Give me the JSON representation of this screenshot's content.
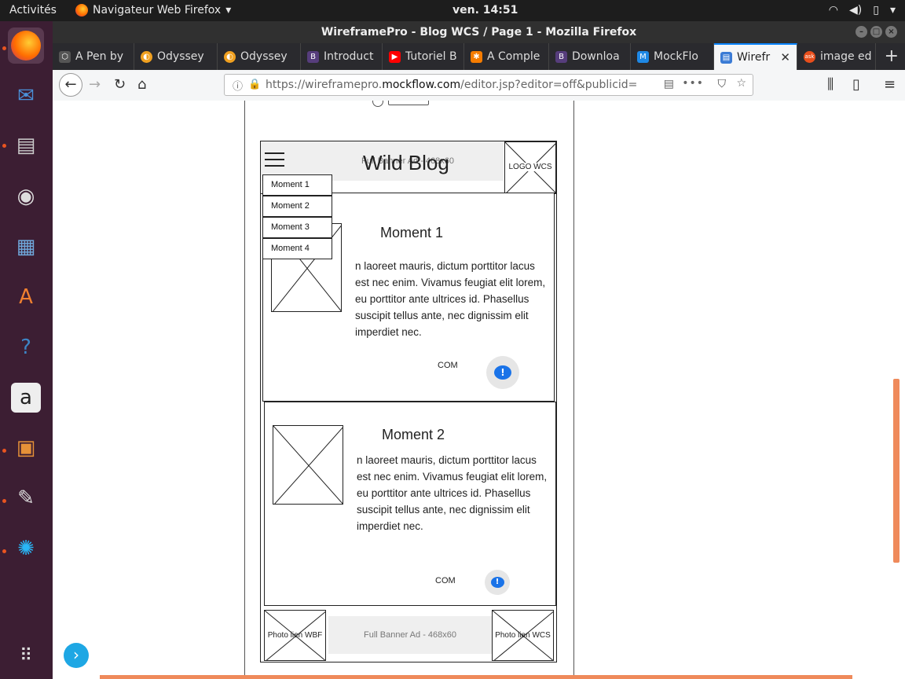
{
  "topbar": {
    "activities": "Activités",
    "app_name": "Navigateur Web Firefox",
    "clock": "ven. 14:51"
  },
  "window": {
    "title": "WireframePro - Blog WCS / Page 1 - Mozilla Firefox"
  },
  "tabs": [
    {
      "label": "A Pen by",
      "icon": "codepen-icon",
      "color": "#444444"
    },
    {
      "label": "Odyssey",
      "icon": "odyssey-icon",
      "color": "#f0a020"
    },
    {
      "label": "Odyssey",
      "icon": "odyssey-icon",
      "color": "#f0a020"
    },
    {
      "label": "Introduct",
      "icon": "bootstrap-icon",
      "color": "#563d7c"
    },
    {
      "label": "Tutoriel B",
      "icon": "youtube-icon",
      "color": "#ff0000"
    },
    {
      "label": "A Comple",
      "icon": "asterisk-icon",
      "color": "#f57c00"
    },
    {
      "label": "Downloa",
      "icon": "bootstrap-icon",
      "color": "#563d7c"
    },
    {
      "label": "MockFlo",
      "icon": "mockflow-icon",
      "color": "#1e88e5"
    },
    {
      "label": "Wirefr",
      "icon": "wireframe-icon",
      "color": "#3a7bd5"
    },
    {
      "label": "image ed",
      "icon": "ask-icon",
      "color": "#e94e1b"
    }
  ],
  "nav": {
    "url_prefix": "https://wireframepro.",
    "url_domain": "mockflow.com",
    "url_suffix": "/editor.jsp?editor=off&publicid="
  },
  "wireframe": {
    "header": {
      "title": "Wild Blog",
      "banner_text": "Full Banner Ad - 468x60",
      "logo_label": "LOGO WCS"
    },
    "menu": [
      "Moment 1",
      "Moment 2",
      "Moment 3",
      "Moment 4"
    ],
    "posts": [
      {
        "title": "Moment 1",
        "body": "n laoreet mauris, dictum porttitor lacus est nec enim. Vivamus feugiat elit lorem, eu porttitor ante ultrices id. Phasellus suscipit tellus ante, nec dignissim elit imperdiet nec.",
        "com_label": "COM",
        "bubble_icon": "!"
      },
      {
        "title": "Moment 2",
        "body": "n laoreet mauris, dictum porttitor lacus est nec enim. Vivamus feugiat elit lorem, eu porttitor ante ultrices id. Phasellus suscipit tellus ante, nec dignissim elit imperdiet nec.",
        "com_label": "COM",
        "bubble_icon": "!"
      }
    ],
    "footer": {
      "left_label": "Photo lien WBF",
      "banner_text": "Full Banner Ad - 468x60",
      "right_label": "Photo lien WCS"
    }
  }
}
